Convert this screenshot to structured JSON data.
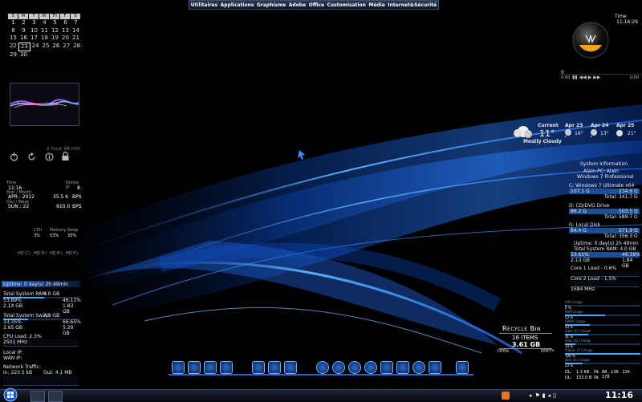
{
  "topmenu": [
    "Utilitaires",
    "Applications",
    "Graphisme",
    "Adobe",
    "Office",
    "Customisation",
    "Média",
    "Internet&Sécurité"
  ],
  "calendar": {
    "days_header": [
      "S",
      "M",
      "T",
      "W",
      "Th",
      "F",
      "S"
    ],
    "weeks": [
      [
        "1",
        "2",
        "3",
        "4",
        "5",
        "6",
        "7"
      ],
      [
        "8",
        "9",
        "10",
        "11",
        "12",
        "13",
        "14"
      ],
      [
        "15",
        "16",
        "17",
        "18",
        "19",
        "20",
        "21"
      ],
      [
        "22",
        "23",
        "24",
        "25",
        "26",
        "27",
        "28"
      ],
      [
        "29",
        "30",
        "",
        "",
        "",
        "",
        ""
      ]
    ],
    "week_prefix": [
      "",
      "",
      "",
      "",
      ""
    ],
    "today": "23"
  },
  "power": {
    "uptime_text": "2 hour 48 min"
  },
  "clock_gadget": {
    "time_label": "Time",
    "time": "11:16",
    "date_label": "Year / Month",
    "date": "APR : 2012",
    "day_label": "Day / Week",
    "day": "SUN : 22",
    "online_label": "Online IP",
    "online": "8",
    "down": "35.5 K",
    "down_unit": "BPS",
    "up": "810.0",
    "up_unit": "BPS"
  },
  "usage": {
    "cols": [
      {
        "label": "CPU",
        "value": "3%"
      },
      {
        "label": "Memory",
        "value": "53%"
      },
      {
        "label": "Swap",
        "value": "33%"
      }
    ],
    "hd": [
      "HD C:\\",
      "HD D:\\",
      "HD E:\\",
      "HD F:\\"
    ]
  },
  "left_sys": {
    "uptime_label": "Uptime:",
    "uptime": "0 day(s) 2h 49min",
    "ram_label": "Total System RAM:",
    "ram": "4.0 GB",
    "ram_pct": "53.89%",
    "ram_free_pct": "46.11%",
    "ram_used": "2.14 GB",
    "ram_free": "1.83 GB",
    "swap_label": "Total System Swap:",
    "swap": "7.9 GB",
    "swap_pct": "33.35%",
    "swap_free_pct": "66.65%",
    "swap_used": "2.65 GB",
    "swap_free": "5.29 GB",
    "cpu_label": "CPU Load: 2.3%",
    "cpu_mhz": "2501 MHz",
    "local_ip": "Local IP:",
    "wan_ip": "WAN IP:",
    "net_label": "Network Traffic:",
    "in": "In: 223.5 kB",
    "out": "Out: 4.1 MB"
  },
  "top_right": {
    "time_label": "Time",
    "time": "11:16:29",
    "media_zero": "0",
    "media_time": "0:00",
    "media_end": "0:00"
  },
  "weather": {
    "current_label": "Current",
    "temp": "11°",
    "condition": "Mostly Cloudy",
    "forecast": [
      {
        "day": "Apr 23",
        "temp": "16°"
      },
      {
        "day": "Apr 24",
        "temp": "13°"
      },
      {
        "day": "Apr 25",
        "temp": "21°"
      }
    ]
  },
  "sysinfo": {
    "title": "System Information",
    "pc": "Alain-PC: Alain",
    "os": "Windows 7 Professional",
    "drives": [
      {
        "name": "C: Windows 7 Ultimate x64",
        "used": "107.1 G",
        "free": "234.6 G",
        "total": "Total: 341.7 G"
      },
      {
        "name": "D: CD/DVD Drive",
        "used": "86.2 G",
        "free": "503.5 G",
        "total": "Total: 589.7 G"
      },
      {
        "name": "G: Local Disk",
        "used": "84.4 G",
        "free": "271.9 G",
        "total": "Total: 356.3 G"
      }
    ],
    "uptime": "Uptime: 0 day(s) 2h 49min",
    "ram": "Total System RAM: 4.0 GB",
    "ram_pct": "53.61%",
    "ram_free_pct": "46.39%",
    "ram_used": "2.13 GB",
    "ram_free": "1.84 GB",
    "core1": "Core 1 Load - 0.6%",
    "core2": "Core 2 Load - 1.5%",
    "mhz": "1584 MHz"
  },
  "right_meters": {
    "rows": [
      {
        "label": "CPU Usage",
        "value": "2 %"
      },
      {
        "label": "RAM Usage",
        "value": "53 %"
      },
      {
        "label": "SWAP Usage",
        "value": "33 %"
      },
      {
        "label": "Alain (C:) Usage",
        "value": "31 %"
      },
      {
        "label": "Alain (D:) Usage",
        "value": "14 %"
      },
      {
        "label": "Vidéos (F:) Usage",
        "value": "100 %"
      },
      {
        "label": "Disk (G:) Usage",
        "value": "23 %"
      }
    ],
    "dl_label": "DL:",
    "dl": "1.3 KB",
    "ul_label": "UL:",
    "ul": "152.0 B",
    "ip_label": "IN:",
    "ip": "88 . 138 . 226 . 178",
    "gw_label": "IN:"
  },
  "recycle": {
    "title": "Recycle Bin",
    "items": "16 items",
    "size": "3.61 GB",
    "open": "Open",
    "empty": "Empty"
  },
  "taskbar": {
    "time": "11:16"
  },
  "colors": {
    "accent": "#3a8cff",
    "dark": "#000000",
    "text": "#cfd8e6"
  }
}
